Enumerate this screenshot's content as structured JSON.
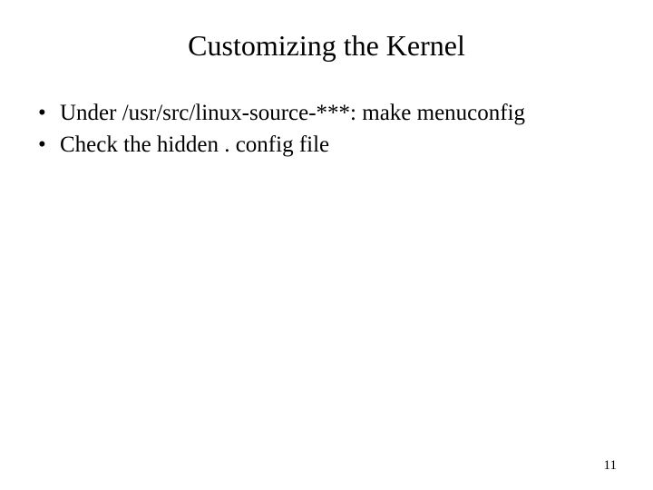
{
  "slide": {
    "title": "Customizing the Kernel",
    "bullets": [
      "Under /usr/src/linux-source-***: make menuconfig",
      "Check the hidden . config file"
    ],
    "page_number": "11"
  }
}
